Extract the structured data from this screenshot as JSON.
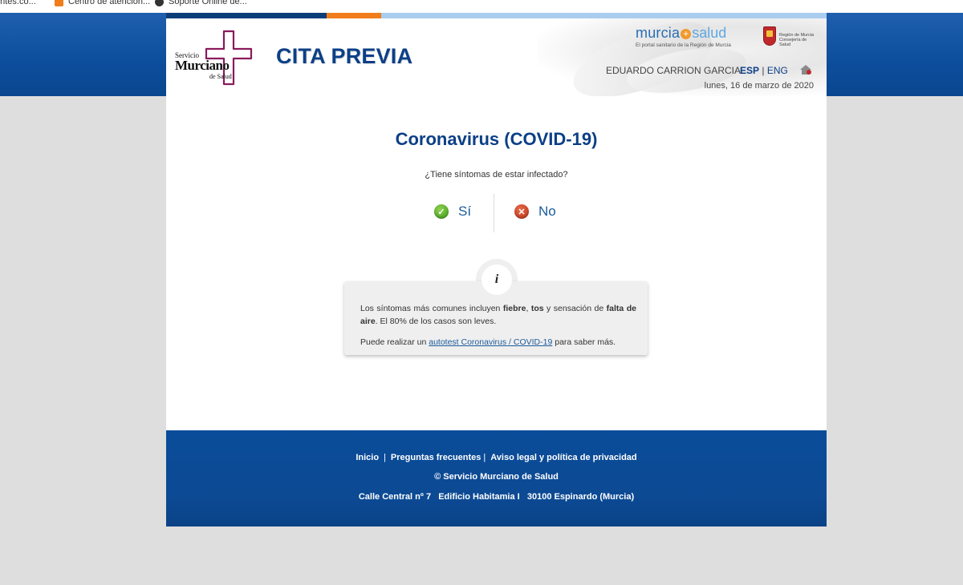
{
  "bookmarks": [
    {
      "label": "entes.co...",
      "icon": "bookmark-icon"
    },
    {
      "label": "Centro de atención...",
      "icon": "orange-bookmark-icon"
    },
    {
      "label": "Soporte Online de...",
      "icon": "support-icon"
    }
  ],
  "header": {
    "logo_line1": "Servicio",
    "logo_line2": "Murciano",
    "logo_line3": "de Salud",
    "app_title": "CITA PREVIA",
    "portal_word1": "murcia",
    "portal_word2": "salud",
    "portal_tagline": "El portal sanitario de la Región de Murcia",
    "region_line1": "Región de Murcia",
    "region_line2": "Consejería de Salud",
    "user_name": "EDUARDO CARRION GARCIA",
    "lang_esp": "ESP",
    "lang_sep": "|",
    "lang_eng": "ENG",
    "date": "lunes, 16 de marzo de 2020"
  },
  "main": {
    "title": "Coronavirus (COVID-19)",
    "question": "¿Tiene síntomas de estar infectado?",
    "yes_label": "Sí",
    "no_label": "No",
    "info_icon": "i",
    "info_text_a": "Los síntomas más comunes incluyen ",
    "info_bold_fever": "fiebre",
    "info_text_b": ", ",
    "info_bold_cough": "tos",
    "info_text_c": " y sensación de ",
    "info_bold_air": "falta de aire",
    "info_text_d": ". El 80% de los casos son leves.",
    "info_link_prefix": "Puede realizar un ",
    "info_link_text": "autotest Coronavirus / COVID-19",
    "info_link_suffix": " para saber más."
  },
  "footer": {
    "link_home": "Inicio",
    "link_faq": "Preguntas frecuentes",
    "link_legal": "Aviso legal y política de privacidad",
    "sep": "|",
    "copyright": "© Servicio Murciano de Salud",
    "address": "Calle Central nº 7   Edificio Habitamia I   30100 Espinardo (Murcia)"
  },
  "colors": {
    "brand_blue": "#0c3f87",
    "accent_orange": "#f07d1a",
    "yes_green": "#3c9a1a",
    "no_red": "#b7321a",
    "logo_purple": "#8a1a5c"
  }
}
